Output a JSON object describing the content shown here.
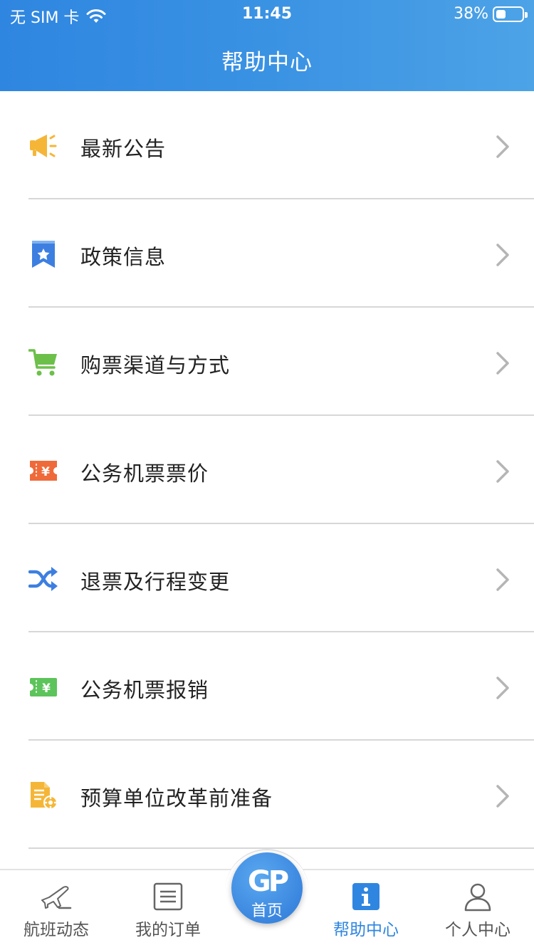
{
  "status_bar": {
    "carrier": "无 SIM 卡",
    "time": "11:45",
    "battery": "38%",
    "battery_level": 0.38
  },
  "header": {
    "title": "帮助中心"
  },
  "menu": {
    "items": [
      {
        "label": "最新公告",
        "icon": "megaphone-icon",
        "color": "#f5b637"
      },
      {
        "label": "政策信息",
        "icon": "bookmark-star-icon",
        "color": "#3d7fe0"
      },
      {
        "label": "购票渠道与方式",
        "icon": "cart-icon",
        "color": "#6cc04a"
      },
      {
        "label": "公务机票票价",
        "icon": "yen-ticket-icon",
        "color": "#ef6a3a"
      },
      {
        "label": "退票及行程变更",
        "icon": "shuffle-icon",
        "color": "#3d7fe0"
      },
      {
        "label": "公务机票报销",
        "icon": "yen-voucher-icon",
        "color": "#5cc45a"
      },
      {
        "label": "预算单位改革前准备",
        "icon": "document-gear-icon",
        "color": "#f5b637"
      }
    ]
  },
  "tabbar": {
    "tabs": [
      {
        "label": "航班动态",
        "icon": "plane-icon"
      },
      {
        "label": "我的订单",
        "icon": "order-list-icon"
      },
      {
        "label": "首页",
        "icon": "gp-logo-icon",
        "logo_text": "GP"
      },
      {
        "label": "帮助中心",
        "icon": "info-icon",
        "active": true
      },
      {
        "label": "个人中心",
        "icon": "person-icon"
      }
    ]
  },
  "colors": {
    "header_start": "#2f86e0",
    "header_end": "#4da3e6",
    "active_tab": "#2f86e0"
  }
}
